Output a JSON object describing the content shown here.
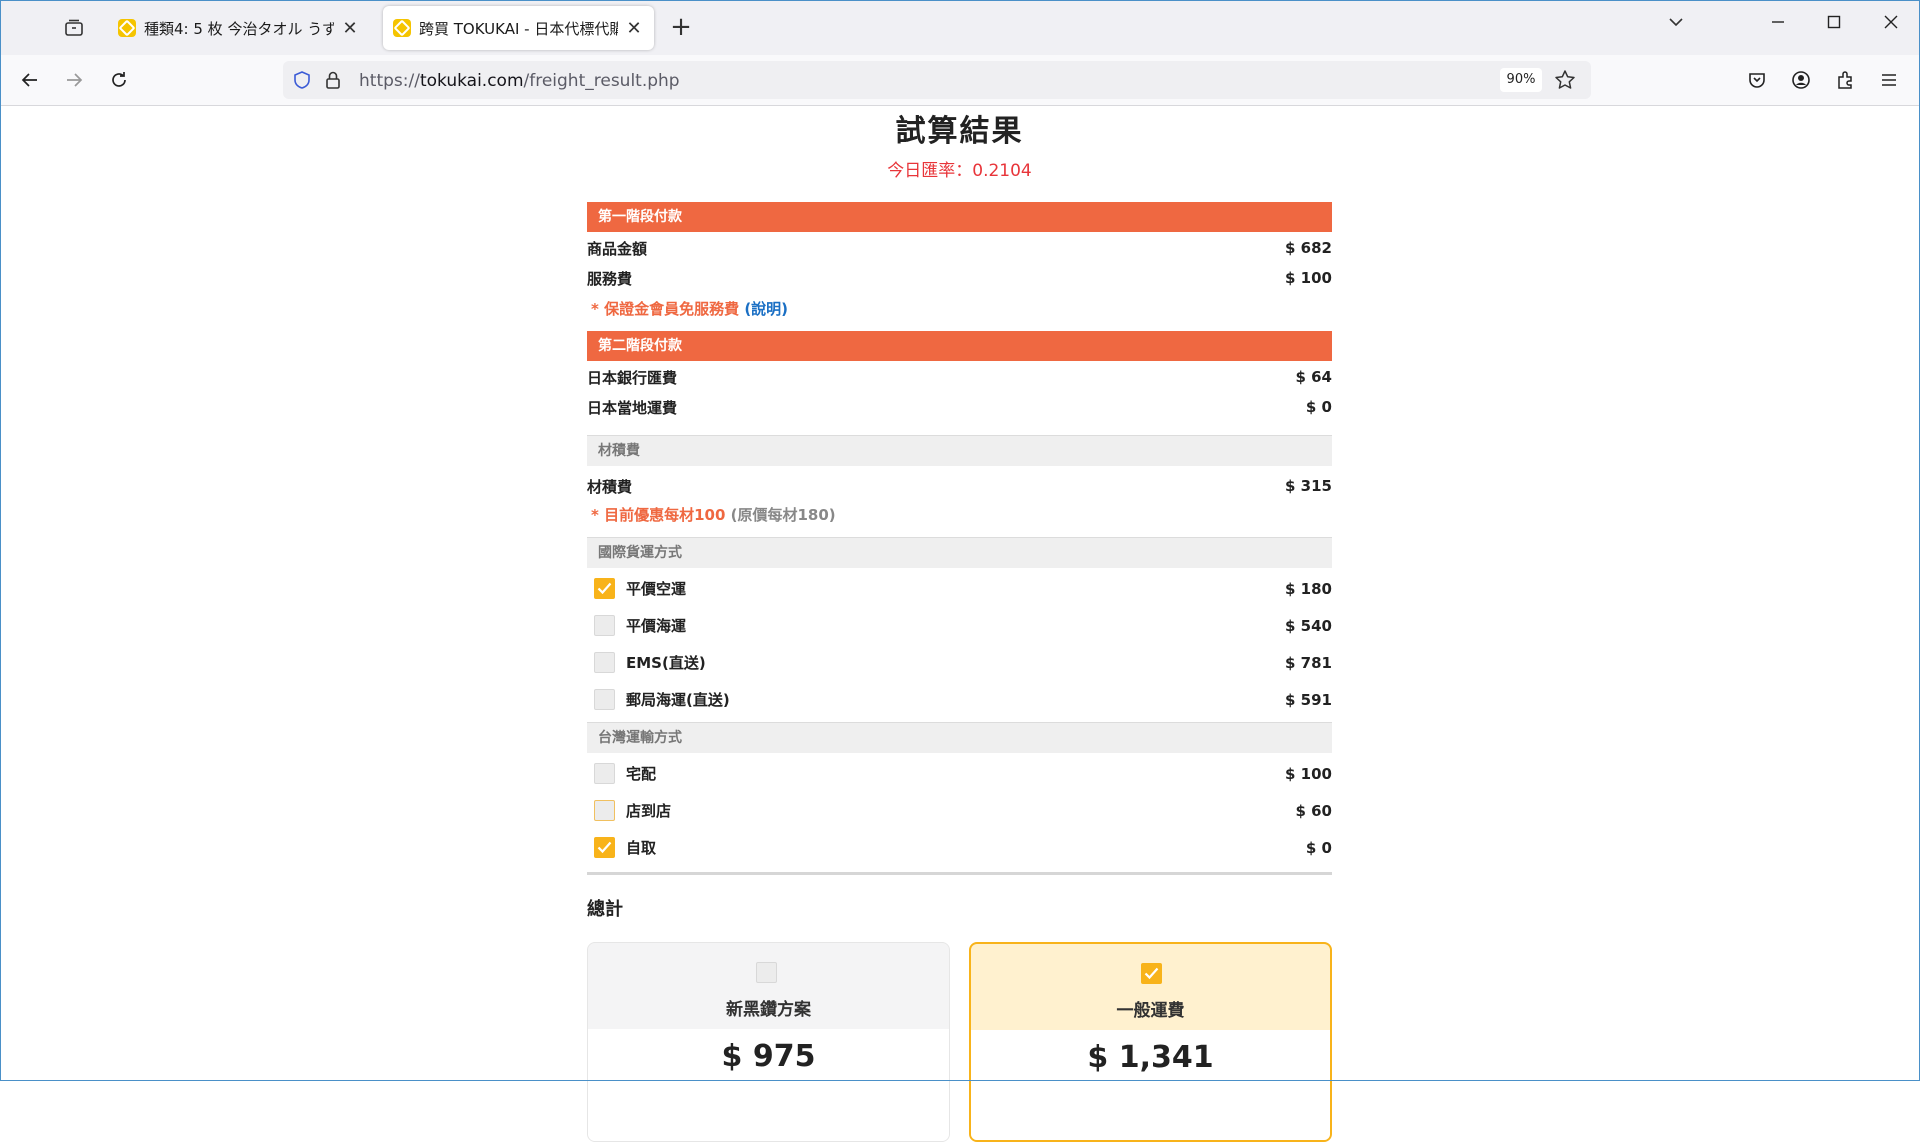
{
  "browser": {
    "tabs": [
      {
        "title": "種類4: 5 枚 今治タオル うずしま",
        "active": false
      },
      {
        "title": "跨買 TOKUKAI - 日本代標代購",
        "active": true
      }
    ],
    "url_prefix": "https://",
    "url_host": "tokukai.com",
    "url_path": "/freight_result.php",
    "zoom": "90%"
  },
  "page": {
    "title": "試算結果",
    "rate_label": "今日匯率：0.2104"
  },
  "stage1": {
    "header": "第一階段付款",
    "rows": [
      {
        "label": "商品金額",
        "value": "$ 682"
      },
      {
        "label": "服務費",
        "value": "$ 100"
      }
    ],
    "note": "* 保證金會員免服務費",
    "note_link": "(說明)"
  },
  "stage2": {
    "header": "第二階段付款",
    "rows": [
      {
        "label": "日本銀行匯費",
        "value": "$ 64"
      },
      {
        "label": "日本當地運費",
        "value": "$ 0"
      }
    ]
  },
  "volume": {
    "header": "材積費",
    "row": {
      "label": "材積費",
      "value": "$ 315"
    },
    "note": "* 目前優惠每材100",
    "note_grey": "(原價每材180)"
  },
  "intl": {
    "header": "國際貨運方式",
    "options": [
      {
        "label": "平價空運",
        "value": "$ 180",
        "checked": true
      },
      {
        "label": "平價海運",
        "value": "$ 540",
        "checked": false
      },
      {
        "label": "EMS(直送)",
        "value": "$ 781",
        "checked": false
      },
      {
        "label": "郵局海運(直送)",
        "value": "$ 591",
        "checked": false
      }
    ]
  },
  "taiwan": {
    "header": "台灣運輸方式",
    "options": [
      {
        "label": "宅配",
        "value": "$ 100",
        "checked": false
      },
      {
        "label": "店到店",
        "value": "$ 60",
        "checked": false
      },
      {
        "label": "自取",
        "value": "$ 0",
        "checked": true
      }
    ]
  },
  "total": {
    "label": "總計",
    "plans": [
      {
        "name": "新黑鑽方案",
        "price": "$ 975",
        "checked": false
      },
      {
        "name": "一般運費",
        "price": "$ 1,341",
        "checked": true
      }
    ]
  },
  "colors": {
    "section_header": "#ef6841",
    "checkbox_on": "#f8b31a",
    "rate_text": "#e8353a",
    "link": "#1a6fc4"
  },
  "icons": [
    "tab-list-icon",
    "back-arrow-icon",
    "forward-arrow-icon",
    "reload-icon",
    "shield-icon",
    "lock-icon",
    "star-icon",
    "pocket-icon",
    "account-icon",
    "extensions-icon",
    "menu-icon"
  ]
}
